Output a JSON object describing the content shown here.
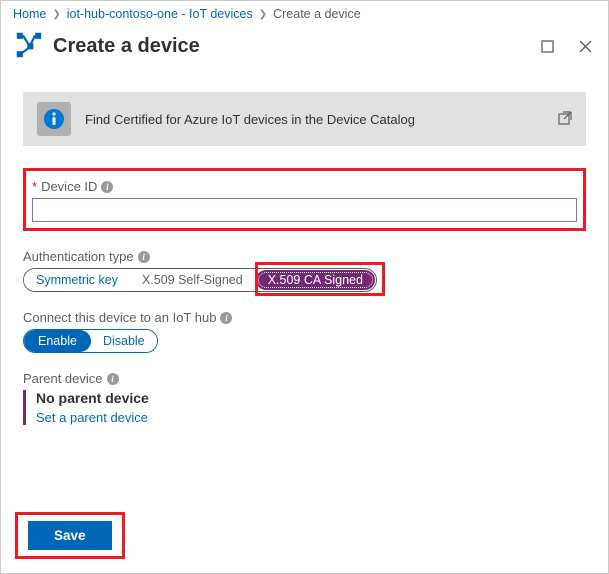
{
  "breadcrumb": {
    "home": "Home",
    "hub": "iot-hub-contoso-one - IoT devices",
    "current": "Create a device"
  },
  "header": {
    "title": "Create a device"
  },
  "infoBar": {
    "text": "Find Certified for Azure IoT devices in the Device Catalog"
  },
  "deviceId": {
    "label": "Device ID",
    "value": ""
  },
  "authType": {
    "label": "Authentication type",
    "options": {
      "symmetric": "Symmetric key",
      "selfSigned": "X.509 Self-Signed",
      "caSigned": "X.509 CA Signed"
    }
  },
  "connect": {
    "label": "Connect this device to an IoT hub",
    "enable": "Enable",
    "disable": "Disable"
  },
  "parent": {
    "label": "Parent device",
    "none": "No parent device",
    "setLink": "Set a parent device"
  },
  "actions": {
    "save": "Save"
  }
}
